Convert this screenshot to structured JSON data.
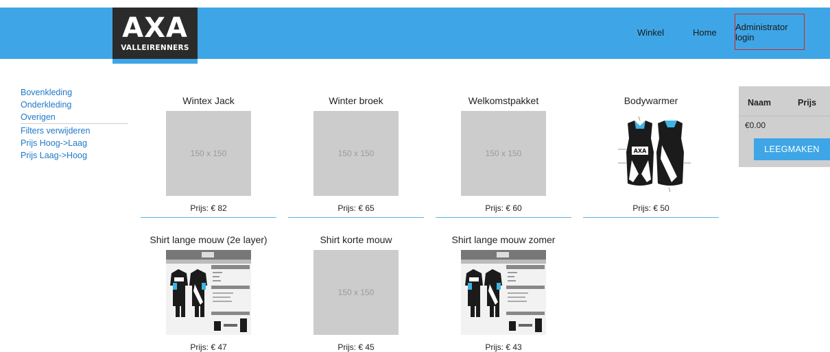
{
  "brand": {
    "logo_main": "AXA",
    "logo_sub": "VALLEIRENNERS"
  },
  "nav": {
    "winkel": "Winkel",
    "home": "Home",
    "admin_login": "Administrator login"
  },
  "sidebar": {
    "categories": [
      "Bovenkleding",
      "Onderkleding",
      "Overigen"
    ],
    "filters": [
      "Filters verwijderen",
      "Prijs Hoog->Laag",
      "Prijs Laag->Hoog"
    ]
  },
  "products": [
    {
      "title": "Wintex Jack",
      "price": "Prijs: € 82",
      "image": "placeholder",
      "placeholder_text": "150 x 150"
    },
    {
      "title": "Winter broek",
      "price": "Prijs: € 65",
      "image": "placeholder",
      "placeholder_text": "150 x 150"
    },
    {
      "title": "Welkomstpakket",
      "price": "Prijs: € 60",
      "image": "placeholder",
      "placeholder_text": "150 x 150"
    },
    {
      "title": "Bodywarmer",
      "price": "Prijs: € 50",
      "image": "bodywarmer"
    },
    {
      "title": "Shirt lange mouw (2e layer)",
      "price": "Prijs: € 47",
      "image": "jersey-sheet"
    },
    {
      "title": "Shirt korte mouw",
      "price": "Prijs: € 45",
      "image": "placeholder",
      "placeholder_text": "150 x 150"
    },
    {
      "title": "Shirt lange mouw zomer",
      "price": "Prijs: € 43",
      "image": "jersey-sheet"
    }
  ],
  "cart": {
    "col_naam": "Naam",
    "col_prijs": "Prijs",
    "total": "€0.00",
    "clear_button": "LEEGMAKEN"
  },
  "colors": {
    "header_blue": "#3ea6e6",
    "logo_dark": "#2b2b2b",
    "link_blue": "#1f78c8",
    "cart_gray": "#cfcfcf",
    "admin_border": "#d42121"
  }
}
